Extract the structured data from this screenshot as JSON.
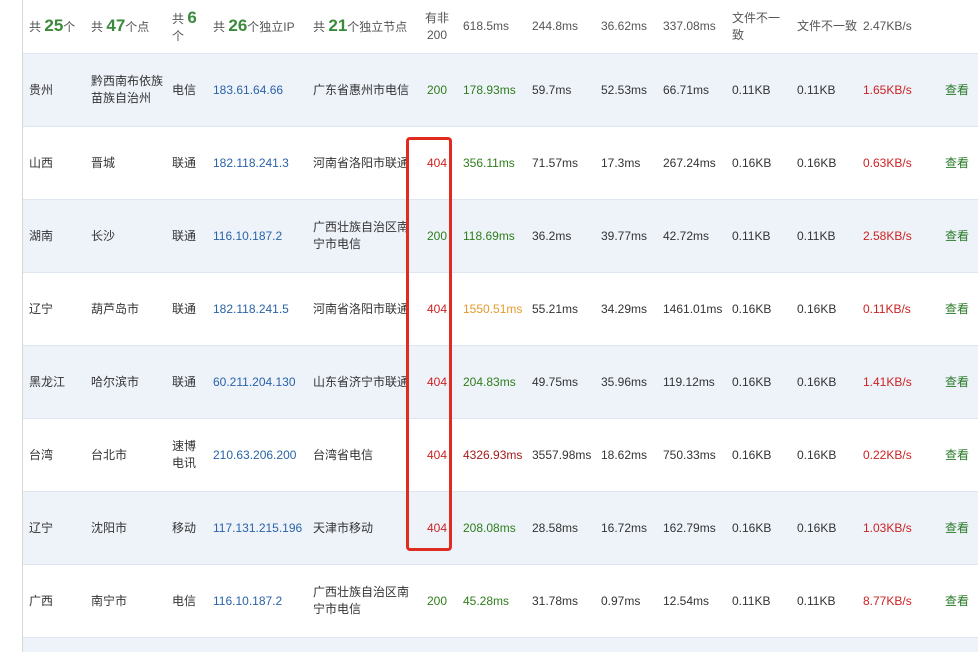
{
  "summary": {
    "provinces": {
      "prefix": "共",
      "count": "25",
      "suffix": "个"
    },
    "points": {
      "prefix": "共",
      "count": "47",
      "suffix": "个点"
    },
    "isps": {
      "prefix": "共",
      "count": "6",
      "suffix": "个"
    },
    "ips": {
      "prefix": "共",
      "count": "26",
      "suffix": "个独立IP"
    },
    "nodes": {
      "prefix": "共",
      "count": "21",
      "suffix": "个独立节点"
    },
    "non200": "有非200",
    "total_time": "618.5ms",
    "resolve_time": "244.8ms",
    "connect_time": "36.62ms",
    "download_time": "337.08ms",
    "file_size_note": "文件不一致",
    "file_size_note2": "文件不一致",
    "speed": "2.47KB/s"
  },
  "rows": [
    {
      "province": "贵州",
      "city": "黔西南布依族苗族自治州",
      "isp": "电信",
      "ip": "183.61.64.66",
      "node": "广东省惠州市电信",
      "status": "200",
      "total": "178.93ms",
      "resolve": "59.7ms",
      "connect": "52.53ms",
      "download": "66.71ms",
      "size1": "0.11KB",
      "size2": "0.11KB",
      "speed": "1.65KB/s",
      "action": "查看"
    },
    {
      "province": "山西",
      "city": "晋城",
      "isp": "联通",
      "ip": "182.118.241.3",
      "node": "河南省洛阳市联通",
      "status": "404",
      "total": "356.11ms",
      "resolve": "71.57ms",
      "connect": "17.3ms",
      "download": "267.24ms",
      "size1": "0.16KB",
      "size2": "0.16KB",
      "speed": "0.63KB/s",
      "action": "查看"
    },
    {
      "province": "湖南",
      "city": "长沙",
      "isp": "联通",
      "ip": "116.10.187.2",
      "node": "广西壮族自治区南宁市电信",
      "status": "200",
      "total": "118.69ms",
      "resolve": "36.2ms",
      "connect": "39.77ms",
      "download": "42.72ms",
      "size1": "0.11KB",
      "size2": "0.11KB",
      "speed": "2.58KB/s",
      "action": "查看"
    },
    {
      "province": "辽宁",
      "city": "葫芦岛市",
      "isp": "联通",
      "ip": "182.118.241.5",
      "node": "河南省洛阳市联通",
      "status": "404",
      "total": "1550.51ms",
      "resolve": "55.21ms",
      "connect": "34.29ms",
      "download": "1461.01ms",
      "size1": "0.16KB",
      "size2": "0.16KB",
      "speed": "0.11KB/s",
      "action": "查看"
    },
    {
      "province": "黑龙江",
      "city": "哈尔滨市",
      "isp": "联通",
      "ip": "60.211.204.130",
      "node": "山东省济宁市联通",
      "status": "404",
      "total": "204.83ms",
      "resolve": "49.75ms",
      "connect": "35.96ms",
      "download": "119.12ms",
      "size1": "0.16KB",
      "size2": "0.16KB",
      "speed": "1.41KB/s",
      "action": "查看"
    },
    {
      "province": "台湾",
      "city": "台北市",
      "isp": "速博电讯",
      "ip": "210.63.206.200",
      "node": "台湾省电信",
      "status": "404",
      "total": "4326.93ms",
      "resolve": "3557.98ms",
      "connect": "18.62ms",
      "download": "750.33ms",
      "size1": "0.16KB",
      "size2": "0.16KB",
      "speed": "0.22KB/s",
      "action": "查看"
    },
    {
      "province": "辽宁",
      "city": "沈阳市",
      "isp": "移动",
      "ip": "117.131.215.196",
      "node": "天津市移动",
      "status": "404",
      "total": "208.08ms",
      "resolve": "28.58ms",
      "connect": "16.72ms",
      "download": "162.79ms",
      "size1": "0.16KB",
      "size2": "0.16KB",
      "speed": "1.03KB/s",
      "action": "查看"
    },
    {
      "province": "广西",
      "city": "南宁市",
      "isp": "电信",
      "ip": "116.10.187.2",
      "node": "广西壮族自治区南宁市电信",
      "status": "200",
      "total": "45.28ms",
      "resolve": "31.78ms",
      "connect": "0.97ms",
      "download": "12.54ms",
      "size1": "0.11KB",
      "size2": "0.11KB",
      "speed": "8.77KB/s",
      "action": "查看"
    }
  ],
  "colors": {
    "green": "#2f7d1c",
    "orange": "#e69a2a",
    "red": "#cc2222",
    "darkred": "#a31b1b",
    "ip_blue": "#2a63a8",
    "highlight": "#e02b20"
  }
}
